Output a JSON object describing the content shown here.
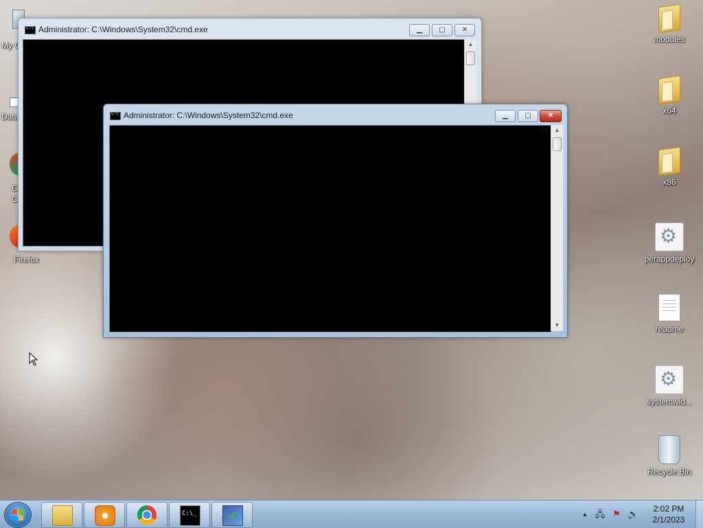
{
  "desktop": {
    "left_partial_labels": [
      "My C",
      "Data",
      "G",
      "C",
      "Firefox"
    ],
    "right_icons": [
      {
        "label": "modules",
        "icon": "folder-icon"
      },
      {
        "label": "x64",
        "icon": "folder-icon"
      },
      {
        "label": "x86",
        "icon": "folder-icon"
      },
      {
        "label": "perappdeploy",
        "icon": "settings-file-icon"
      },
      {
        "label": "readme",
        "icon": "text-document-icon"
      },
      {
        "label": "systemwid...",
        "icon": "settings-file-icon"
      },
      {
        "label": "Recycle Bin",
        "icon": "recycle-bin-icon"
      }
    ]
  },
  "windows": [
    {
      "title": "Administrator: C:\\Windows\\System32\\cmd.exe",
      "state": "inactive"
    },
    {
      "title": "Administrator: C:\\Windows\\System32\\cmd.exe",
      "state": "active"
    }
  ],
  "window_controls": {
    "minimize": "▁",
    "maximize": "▢",
    "close": "✕"
  },
  "taskbar": {
    "pinned": [
      "windows-explorer",
      "media-player",
      "google-chrome",
      "command-prompt",
      "tool-app"
    ],
    "tray": {
      "up_arrow": "▲",
      "network": "🖧",
      "flag": "⚑",
      "volume": "🔊"
    },
    "clock": {
      "time": "2:02 PM",
      "date": "2/1/2023"
    }
  }
}
